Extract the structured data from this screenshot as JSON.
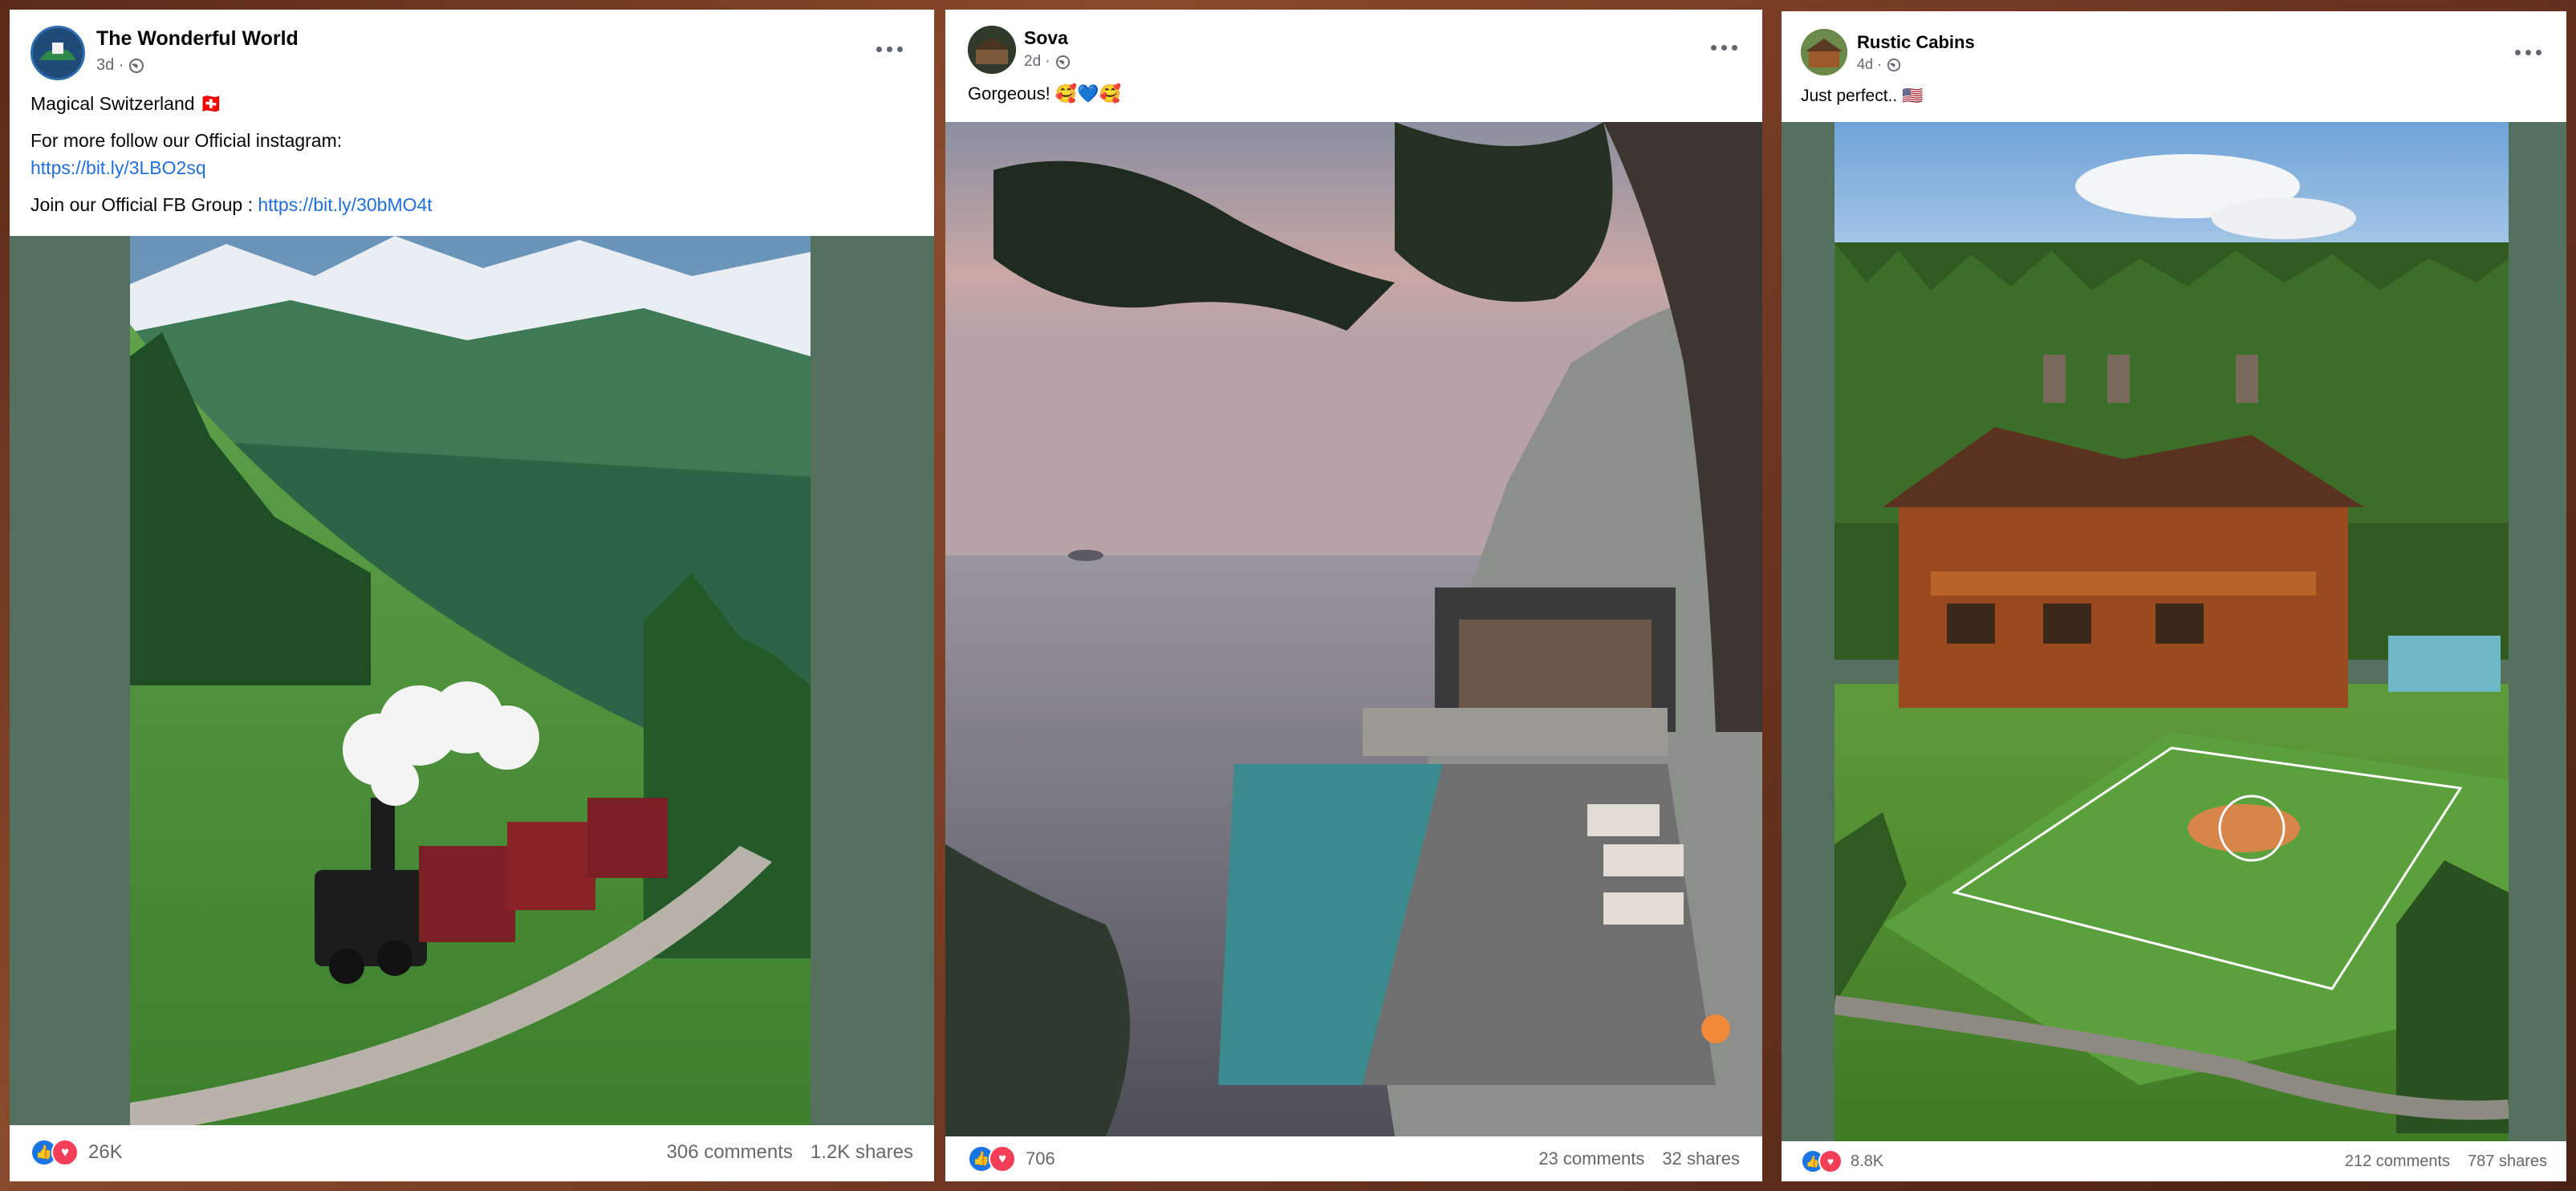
{
  "colors": {
    "like": "#1b74e4",
    "love": "#f33e58",
    "link": "#216fdb",
    "meta": "#65676b",
    "panel": "#5a7a6a"
  },
  "posts": [
    {
      "author": "The Wonderful World",
      "time": "3d ·",
      "caption_line1": "Magical Switzerland 🇨🇭",
      "caption_line2": "For more follow our Official instagram:",
      "instagram_link": "https://bit.ly/3LBO2sq",
      "group_prefix": "Join our Official FB Group : ",
      "group_link": "https://bit.ly/30bMO4t",
      "image_desc_icon": "photo-steam-train-alps",
      "reactions": "26K",
      "comments": "306 comments",
      "shares": "1.2K shares"
    },
    {
      "author": "Sova",
      "time": "2d ·",
      "caption": "Gorgeous! 🥰💙🥰",
      "image_desc_icon": "photo-cliffside-villa-pool",
      "reactions": "706",
      "comments": "23 comments",
      "shares": "32 shares"
    },
    {
      "author": "Rustic Cabins",
      "time": "4d ·",
      "caption": "Just perfect.. 🇺🇸",
      "image_desc_icon": "photo-log-mansion-soccer-field",
      "reactions": "8.8K",
      "comments": "212 comments",
      "shares": "787 shares"
    }
  ]
}
